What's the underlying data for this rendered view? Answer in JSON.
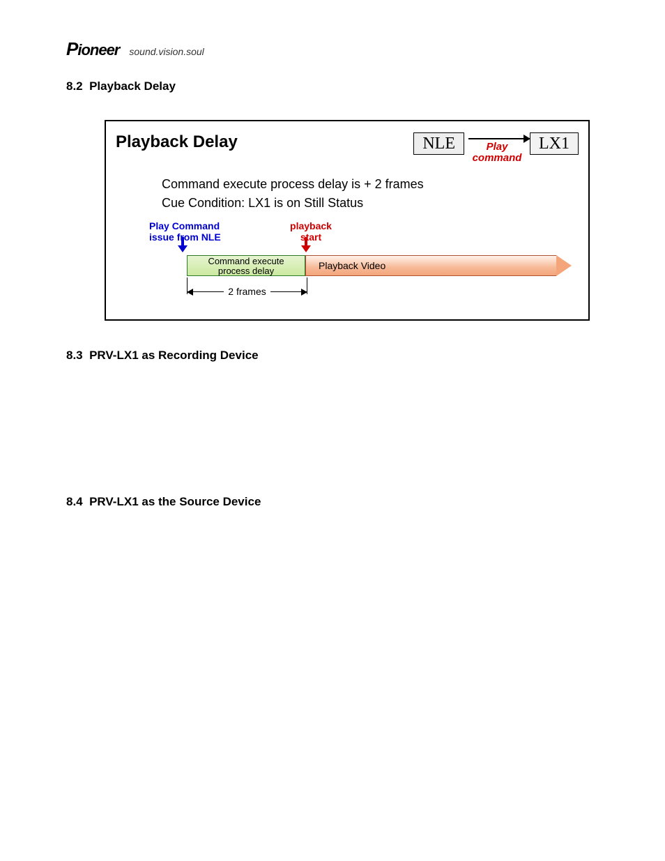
{
  "header": {
    "brand": "Pioneer",
    "tagline": "sound.vision.soul"
  },
  "sections": {
    "s82": {
      "num": "8.2",
      "title": "Playback Delay"
    },
    "s83": {
      "num": "8.3",
      "title": "PRV-LX1 as Recording Device"
    },
    "s84": {
      "num": "8.4",
      "title": "PRV-LX1 as the Source Device"
    }
  },
  "diagram": {
    "title": "Playback Delay",
    "nle": "NLE",
    "lx1": "LX1",
    "arrow_label_1": "Play",
    "arrow_label_2": "command",
    "line1": "Command execute process delay is + 2 frames",
    "line2": "Cue Condition: LX1 is on Still Status",
    "blue_label_1": "Play Command",
    "blue_label_2": "issue from NLE",
    "red_label_1": "playback",
    "red_label_2": "start",
    "bar1_line1": "Command execute",
    "bar1_line2": "process delay",
    "bar2": "Playback Video",
    "dim": "2 frames"
  }
}
